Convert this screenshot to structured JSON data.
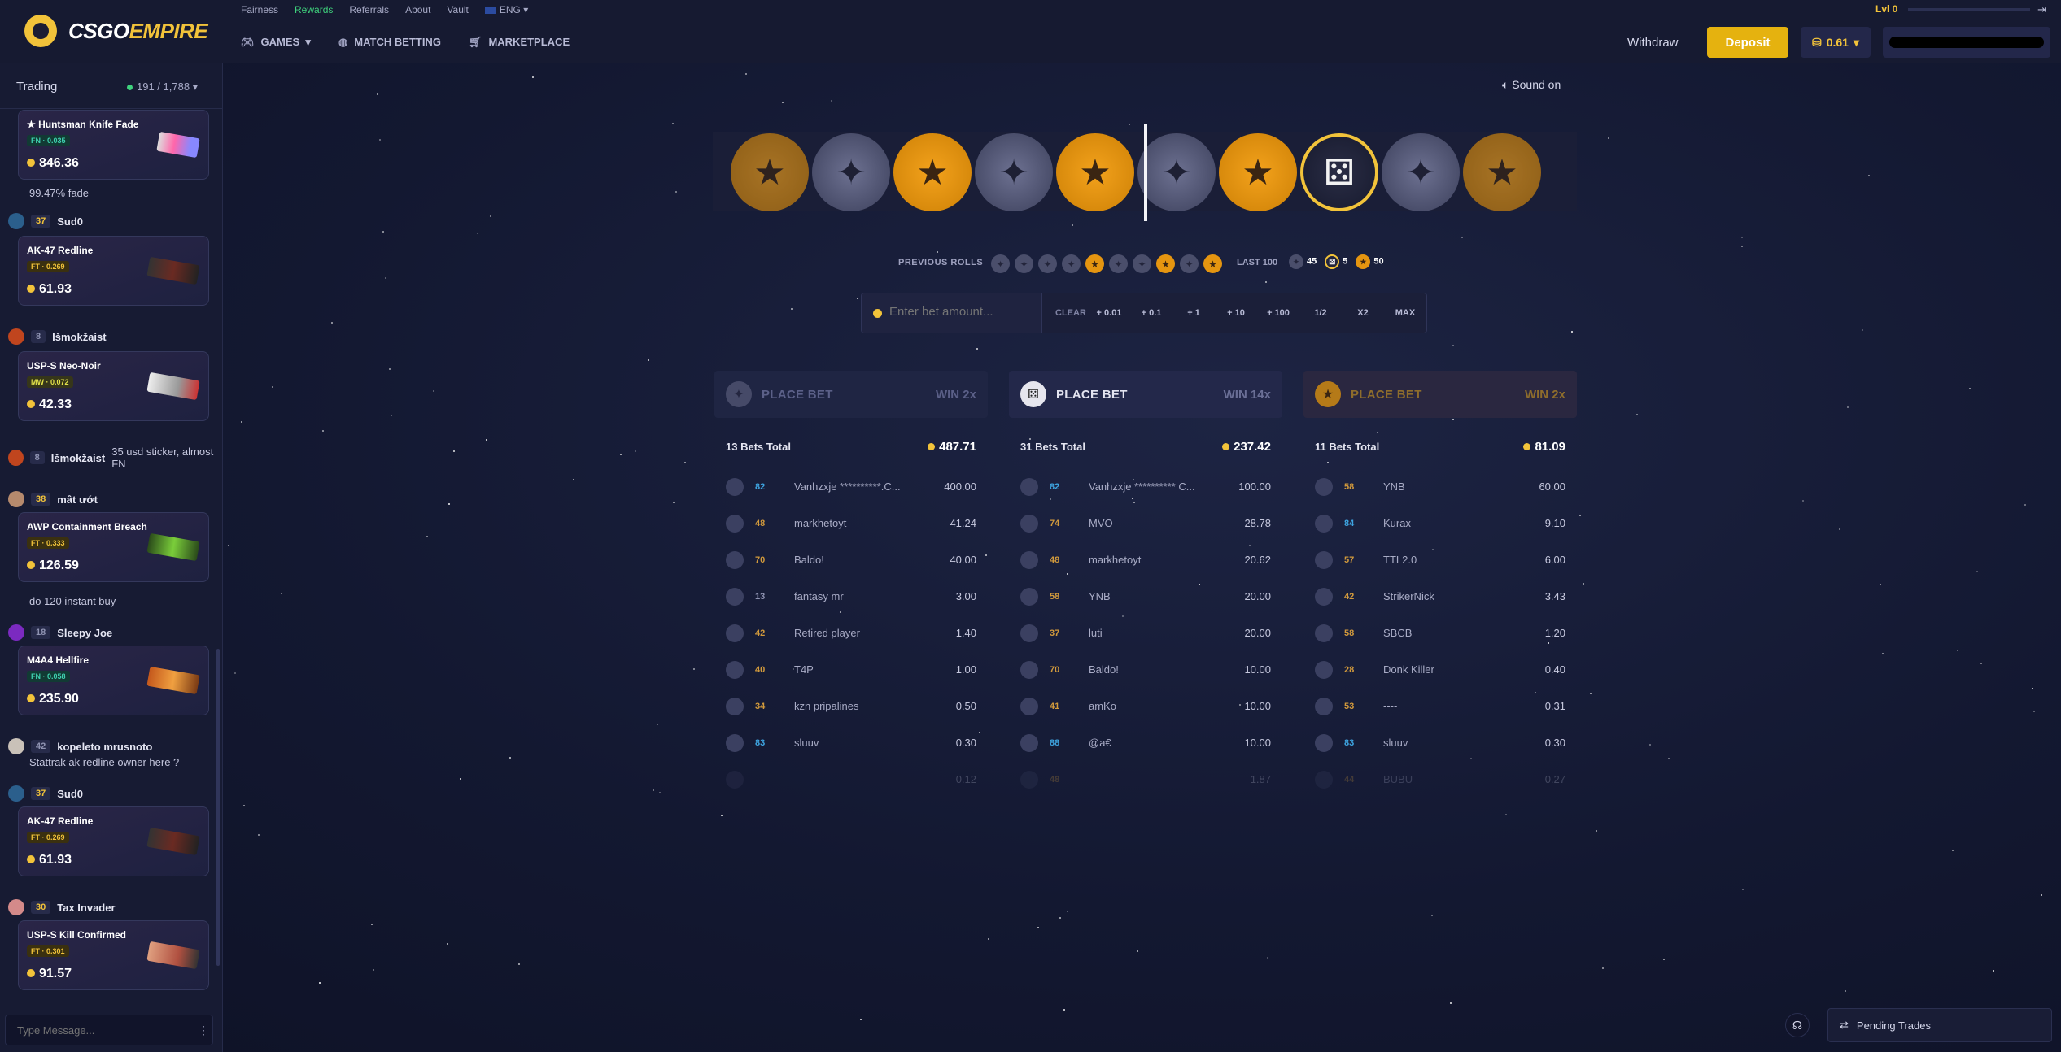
{
  "brand": {
    "name_part1": "CSGO",
    "name_part2": "EMPIRE"
  },
  "top_links": [
    "Fairness",
    "Rewards",
    "Referrals",
    "About",
    "Vault",
    "ENG"
  ],
  "main_nav": [
    {
      "label": "GAMES",
      "icon": "gamepad-icon"
    },
    {
      "label": "MATCH BETTING",
      "icon": "globe-icon"
    },
    {
      "label": "MARKETPLACE",
      "icon": "cart-icon"
    }
  ],
  "header": {
    "withdraw": "Withdraw",
    "deposit": "Deposit",
    "balance": "0.61",
    "level": "Lvl 0"
  },
  "chat": {
    "title": "Trading",
    "online": "191 / 1,788",
    "input_placeholder": "Type Message...",
    "messages": [
      {
        "kind": "item",
        "name": "★ Huntsman Knife Fade",
        "wear": "FN · 0.035",
        "price": "846.36"
      },
      {
        "kind": "text",
        "text": "99.47% fade"
      },
      {
        "kind": "user",
        "level": "37",
        "name": "Sud0"
      },
      {
        "kind": "item",
        "name": "AK-47 Redline",
        "wear": "FT · 0.269",
        "price": "61.93"
      },
      {
        "kind": "user",
        "level": "8",
        "name": "Išmokžaist"
      },
      {
        "kind": "item",
        "name": "USP-S Neo-Noir",
        "wear": "MW · 0.072",
        "price": "42.33"
      },
      {
        "kind": "user",
        "level": "8",
        "name": "Išmokžaist",
        "text": "35 usd sticker, almost FN"
      },
      {
        "kind": "user",
        "level": "38",
        "name": "mât ướt"
      },
      {
        "kind": "item",
        "name": "AWP Containment Breach",
        "wear": "FT · 0.333",
        "price": "126.59"
      },
      {
        "kind": "text",
        "text": "do 120 instant buy"
      },
      {
        "kind": "user",
        "level": "18",
        "name": "Sleepy Joe"
      },
      {
        "kind": "item",
        "name": "M4A4 Hellfire",
        "wear": "FN · 0.058",
        "price": "235.90"
      },
      {
        "kind": "user",
        "level": "42",
        "name": "kopeleto mrusnoto",
        "text": "Stattrak ak redline owner here ?"
      },
      {
        "kind": "user",
        "level": "37",
        "name": "Sud0"
      },
      {
        "kind": "item",
        "name": "AK-47 Redline",
        "wear": "FT · 0.269",
        "price": "61.93"
      },
      {
        "kind": "user",
        "level": "30",
        "name": "Tax Invader"
      },
      {
        "kind": "item",
        "name": "USP-S Kill Confirmed",
        "wear": "FT · 0.301",
        "price": "91.57"
      }
    ]
  },
  "sound": "Sound on",
  "roll_strip": [
    "t",
    "ct",
    "t",
    "ct",
    "t",
    "ct",
    "t",
    "bonus",
    "ct",
    "t"
  ],
  "previous_rolls_label": "PREVIOUS ROLLS",
  "previous_rolls": [
    "ct",
    "ct",
    "ct",
    "ct",
    "t",
    "ct",
    "ct",
    "t",
    "ct",
    "t"
  ],
  "last100": {
    "label": "LAST 100",
    "ct": "45",
    "bonus": "5",
    "t": "50"
  },
  "bet": {
    "placeholder": "Enter bet amount...",
    "buttons": [
      "CLEAR",
      "+ 0.01",
      "+ 0.1",
      "+ 1",
      "+ 10",
      "+ 100",
      "1/2",
      "X2",
      "MAX"
    ]
  },
  "panels": [
    {
      "type": "ct",
      "label": "PLACE BET",
      "win": "WIN 2x",
      "total_label": "13 Bets Total",
      "total": "487.71",
      "bets": [
        {
          "level": "82",
          "name": "Vanhzxje **********.C...",
          "amount": "400.00"
        },
        {
          "level": "48",
          "name": "markhetoyt",
          "amount": "41.24"
        },
        {
          "level": "70",
          "name": "Baldo!",
          "amount": "40.00"
        },
        {
          "level": "13",
          "name": "fantasy mr",
          "amount": "3.00"
        },
        {
          "level": "42",
          "name": "Retired player",
          "amount": "1.40"
        },
        {
          "level": "40",
          "name": "T4P",
          "amount": "1.00"
        },
        {
          "level": "34",
          "name": "kzn pripalines",
          "amount": "0.50"
        },
        {
          "level": "83",
          "name": "sluuv",
          "amount": "0.30"
        },
        {
          "level": "",
          "name": "",
          "amount": "0.12"
        }
      ]
    },
    {
      "type": "bonus",
      "label": "PLACE BET",
      "win": "WIN 14x",
      "total_label": "31 Bets Total",
      "total": "237.42",
      "bets": [
        {
          "level": "82",
          "name": "Vanhzxje ********** C...",
          "amount": "100.00"
        },
        {
          "level": "74",
          "name": "MVO",
          "amount": "28.78"
        },
        {
          "level": "48",
          "name": "markhetoyt",
          "amount": "20.62"
        },
        {
          "level": "58",
          "name": "YNB",
          "amount": "20.00"
        },
        {
          "level": "37",
          "name": "luti",
          "amount": "20.00"
        },
        {
          "level": "70",
          "name": "Baldo!",
          "amount": "10.00"
        },
        {
          "level": "41",
          "name": "amKo",
          "amount": "10.00"
        },
        {
          "level": "88",
          "name": "@a€",
          "amount": "10.00"
        },
        {
          "level": "48",
          "name": "",
          "amount": "1.87"
        }
      ]
    },
    {
      "type": "t",
      "label": "PLACE BET",
      "win": "WIN 2x",
      "total_label": "11 Bets Total",
      "total": "81.09",
      "bets": [
        {
          "level": "58",
          "name": "YNB",
          "amount": "60.00"
        },
        {
          "level": "84",
          "name": "Kurax",
          "amount": "9.10"
        },
        {
          "level": "57",
          "name": "TTL2.0",
          "amount": "6.00"
        },
        {
          "level": "42",
          "name": "StrikerNick",
          "amount": "3.43"
        },
        {
          "level": "58",
          "name": "SBCB",
          "amount": "1.20"
        },
        {
          "level": "28",
          "name": "Donk Killer",
          "amount": "0.40"
        },
        {
          "level": "53",
          "name": "----",
          "amount": "0.31"
        },
        {
          "level": "83",
          "name": "sluuv",
          "amount": "0.30"
        },
        {
          "level": "44",
          "name": "BUBU",
          "amount": "0.27"
        }
      ]
    }
  ],
  "pending": "Pending Trades"
}
